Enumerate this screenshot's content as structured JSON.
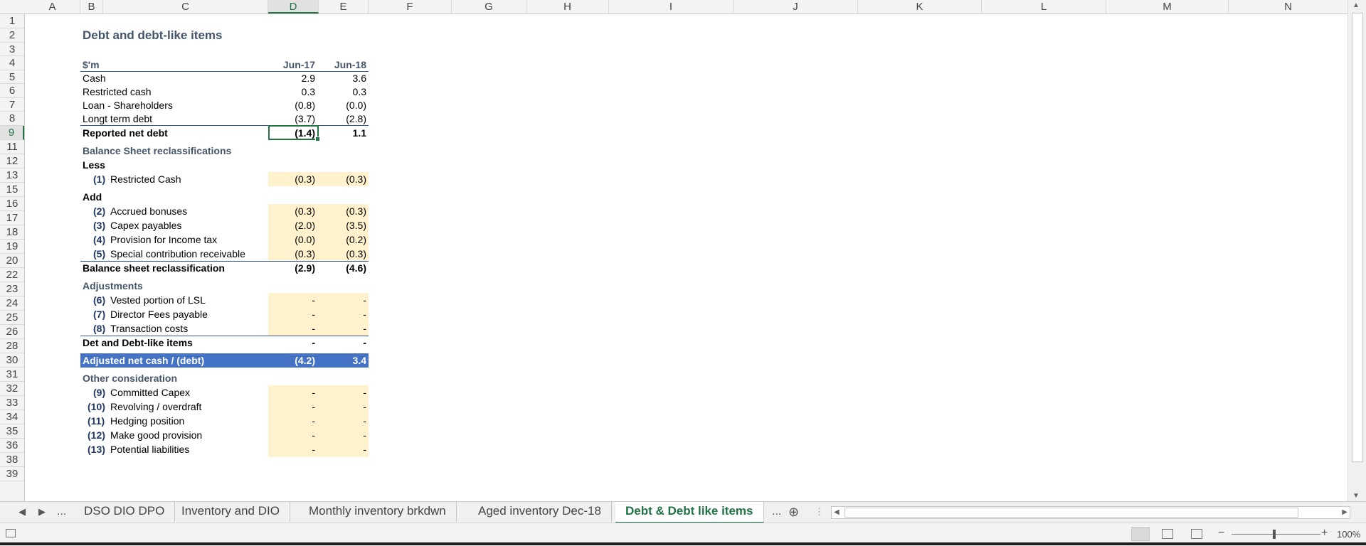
{
  "columns": [
    "A",
    "B",
    "C",
    "D",
    "E",
    "F",
    "G",
    "H",
    "I",
    "J",
    "K",
    "L",
    "M",
    "N"
  ],
  "rows": [
    "1",
    "2",
    "3",
    "4",
    "5",
    "6",
    "7",
    "8",
    "9",
    "11",
    "12",
    "13",
    "15",
    "16",
    "17",
    "18",
    "19",
    "20",
    "22",
    "23",
    "24",
    "25",
    "26",
    "28",
    "30",
    "31",
    "32",
    "33",
    "34",
    "35",
    "36",
    "38",
    "39"
  ],
  "sheet": {
    "title": "Debt and debt-like items",
    "units_label": "$'m",
    "period_1": "Jun-17",
    "period_2": "Jun-18",
    "net_debt_rows": [
      {
        "label": "Cash",
        "v1": "2.9",
        "v2": "3.6"
      },
      {
        "label": "Restricted cash",
        "v1": "0.3",
        "v2": "0.3"
      },
      {
        "label": "Loan - Shareholders",
        "v1": "(0.8)",
        "v2": "(0.0)"
      },
      {
        "label": "Longt term debt",
        "v1": "(3.7)",
        "v2": "(2.8)"
      }
    ],
    "reported_net_debt": {
      "label": "Reported net debt",
      "v1": "(1.4)",
      "v2": "1.1"
    },
    "bs_reclass_header": "Balance Sheet reclassifications",
    "less_label": "Less",
    "less_rows": [
      {
        "num": "(1)",
        "label": "Restricted Cash",
        "v1": "(0.3)",
        "v2": "(0.3)"
      }
    ],
    "add_label": "Add",
    "add_rows": [
      {
        "num": "(2)",
        "label": "Accrued bonuses",
        "v1": "(0.3)",
        "v2": "(0.3)"
      },
      {
        "num": "(3)",
        "label": "Capex payables",
        "v1": "(2.0)",
        "v2": "(3.5)"
      },
      {
        "num": "(4)",
        "label": "Provision for Income tax",
        "v1": "(0.0)",
        "v2": "(0.2)"
      },
      {
        "num": "(5)",
        "label": "Special contribution receivable",
        "v1": "(0.3)",
        "v2": "(0.3)"
      }
    ],
    "bs_reclass_total": {
      "label": "Balance sheet reclassification",
      "v1": "(2.9)",
      "v2": "(4.6)"
    },
    "adjustments_header": "Adjustments",
    "adjustment_rows": [
      {
        "num": "(6)",
        "label": "Vested portion of LSL",
        "v1": "-",
        "v2": "-"
      },
      {
        "num": "(7)",
        "label": "Director Fees payable",
        "v1": "-",
        "v2": "-"
      },
      {
        "num": "(8)",
        "label": "Transaction costs",
        "v1": "-",
        "v2": "-"
      }
    ],
    "debt_like_total": {
      "label": "Det and Debt-like items",
      "v1": "-",
      "v2": "-"
    },
    "adjusted_net": {
      "label": "Adjusted net cash / (debt)",
      "v1": "(4.2)",
      "v2": "3.4"
    },
    "other_header": "Other consideration",
    "other_rows": [
      {
        "num": "(9)",
        "label": "Committed Capex",
        "v1": "-",
        "v2": "-"
      },
      {
        "num": "(10)",
        "label": "Revolving / overdraft",
        "v1": "-",
        "v2": "-"
      },
      {
        "num": "(11)",
        "label": "Hedging position",
        "v1": "-",
        "v2": "-"
      },
      {
        "num": "(12)",
        "label": "Make good provision",
        "v1": "-",
        "v2": "-"
      },
      {
        "num": "(13)",
        "label": "Potential liabilities",
        "v1": "-",
        "v2": "-"
      }
    ]
  },
  "tabs": {
    "overflow": "...",
    "items": [
      "DSO DIO DPO",
      "Inventory and DIO",
      "Monthly inventory brkdwn",
      "Aged inventory Dec-18",
      "Debt & Debt like items"
    ],
    "active": "Debt & Debt like items",
    "more": "..."
  },
  "status": {
    "zoom": "100%"
  },
  "colors": {
    "accent": "#217346",
    "header_blue": "#44546a",
    "highlight_blue": "#4472c4",
    "input_shade": "#fff2cc"
  }
}
